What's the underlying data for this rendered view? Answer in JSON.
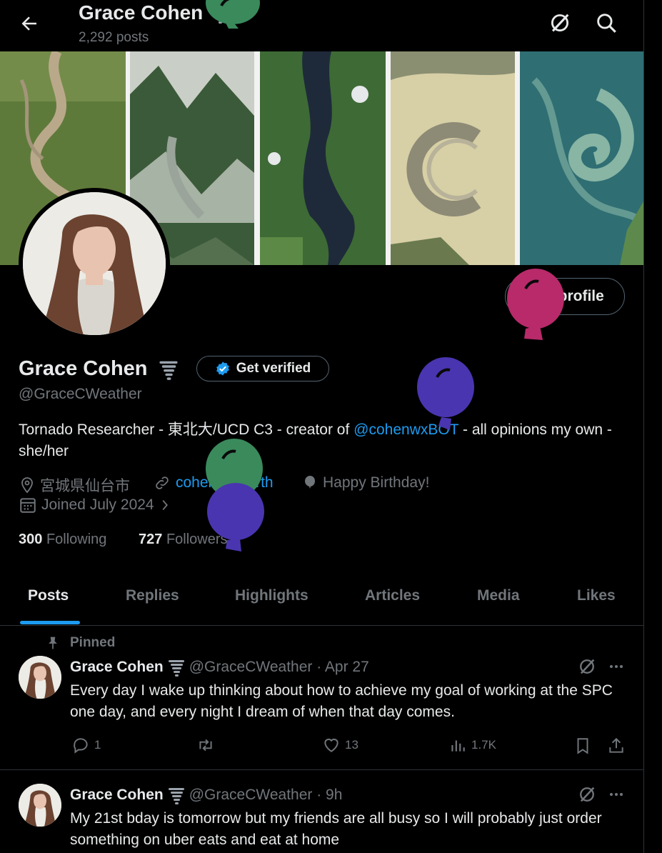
{
  "header": {
    "name": "Grace Cohen",
    "posts_count": "2,292 posts"
  },
  "profile": {
    "display_name": "Grace Cohen",
    "get_verified_label": "Get verified",
    "edit_profile_label": "Edit profile",
    "handle": "@GraceCWeather",
    "bio_before": "Tornado Researcher - 東北大/UCD C3  - creator of ",
    "bio_mention": "@cohenwxBOT",
    "bio_after": " - all opinions my own - she/her",
    "location": "宮城県仙台市",
    "website": "cohenwx.earth",
    "birthday": "Happy Birthday!",
    "joined": "Joined July 2024",
    "following_count": "300",
    "following_label": "Following",
    "followers_count": "727",
    "followers_label": "Followers"
  },
  "tabs": [
    "Posts",
    "Replies",
    "Highlights",
    "Articles",
    "Media",
    "Likes"
  ],
  "posts": [
    {
      "pinned_label": "Pinned",
      "name": "Grace Cohen",
      "meta": "@GraceCWeather · Apr 27",
      "text": "Every day I wake up thinking about how to achieve my goal of working at the SPC one day, and every night I dream of when that day comes.",
      "replies": "1",
      "likes": "13",
      "views": "1.7K"
    },
    {
      "name": "Grace Cohen",
      "meta": "@GraceCWeather · 9h",
      "text": "My 21st bday is tomorrow but my friends are all busy so I will probably just order something on uber eats and eat at home"
    }
  ],
  "colors": {
    "accent": "#1d9bf0",
    "balloon_green": "#3a8a5c",
    "balloon_purple": "#4a35b0",
    "balloon_pink": "#b82a6a"
  }
}
